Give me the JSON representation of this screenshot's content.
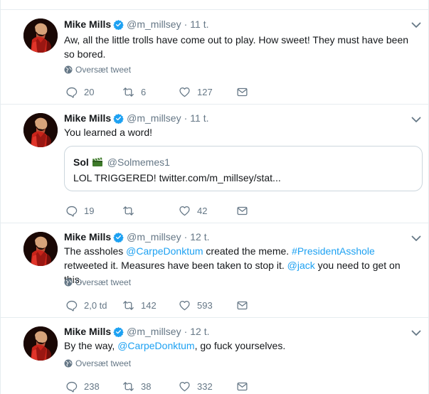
{
  "colors": {
    "text": "#14171a",
    "muted": "#657786",
    "link": "#1da1f2",
    "verified": "#1da1f2",
    "border": "#e6ecf0",
    "quote_border": "#ccd6dd"
  },
  "tweets": [
    {
      "name": "Mike Mills",
      "verified": true,
      "handle": "@m_millsey",
      "separator": "·",
      "time": "11 t.",
      "text_parts": [
        {
          "text": "Aw, all the little trolls have come out to play. How sweet! They must have been so bored.",
          "type": "plain"
        }
      ],
      "translate_label": "Oversæt tweet",
      "reply_count": "20",
      "retweet_count": "6",
      "like_count": "127",
      "icons": [
        "avatar",
        "verified-badge-icon",
        "chevron-down-icon",
        "globe-icon",
        "reply-icon",
        "retweet-icon",
        "like-icon",
        "direct-message-icon"
      ]
    },
    {
      "name": "Mike Mills",
      "verified": true,
      "handle": "@m_millsey",
      "separator": "·",
      "time": "11 t.",
      "text_parts": [
        {
          "text": "You learned a word!",
          "type": "plain"
        }
      ],
      "quote": {
        "name": "Sol",
        "emoji": "clapperboard-emoji",
        "handle": "@Solmemes1",
        "text": "LOL TRIGGERED! twitter.com/m_millsey/stat..."
      },
      "reply_count": "19",
      "retweet_count": "",
      "like_count": "42",
      "icons": [
        "avatar",
        "verified-badge-icon",
        "chevron-down-icon",
        "reply-icon",
        "retweet-icon",
        "like-icon",
        "direct-message-icon"
      ]
    },
    {
      "name": "Mike Mills",
      "verified": true,
      "handle": "@m_millsey",
      "separator": "·",
      "time": "12 t.",
      "text_parts": [
        {
          "text": "The assholes ",
          "type": "plain"
        },
        {
          "text": "@CarpeDonktum",
          "type": "link"
        },
        {
          "text": " created the meme. ",
          "type": "plain"
        },
        {
          "text": "#PresidentAsshole",
          "type": "link"
        },
        {
          "text": " retweeted it. Measures have been taken to stop it. ",
          "type": "plain"
        },
        {
          "text": "@jack",
          "type": "link"
        },
        {
          "text": " you need to get on this.",
          "type": "plain"
        }
      ],
      "translate_label": "Oversæt tweet",
      "reply_count": "2,0 td",
      "retweet_count": "142",
      "like_count": "593",
      "icons": [
        "avatar",
        "verified-badge-icon",
        "chevron-down-icon",
        "globe-icon",
        "reply-icon",
        "retweet-icon",
        "like-icon",
        "direct-message-icon"
      ]
    },
    {
      "name": "Mike Mills",
      "verified": true,
      "handle": "@m_millsey",
      "separator": "·",
      "time": "12 t.",
      "text_parts": [
        {
          "text": "By the way, ",
          "type": "plain"
        },
        {
          "text": "@CarpeDonktum",
          "type": "link"
        },
        {
          "text": ", go fuck yourselves.",
          "type": "plain"
        }
      ],
      "translate_label": "Oversæt tweet",
      "reply_count": "238",
      "retweet_count": "38",
      "like_count": "332",
      "icons": [
        "avatar",
        "verified-badge-icon",
        "chevron-down-icon",
        "globe-icon",
        "reply-icon",
        "retweet-icon",
        "like-icon",
        "direct-message-icon"
      ]
    }
  ]
}
